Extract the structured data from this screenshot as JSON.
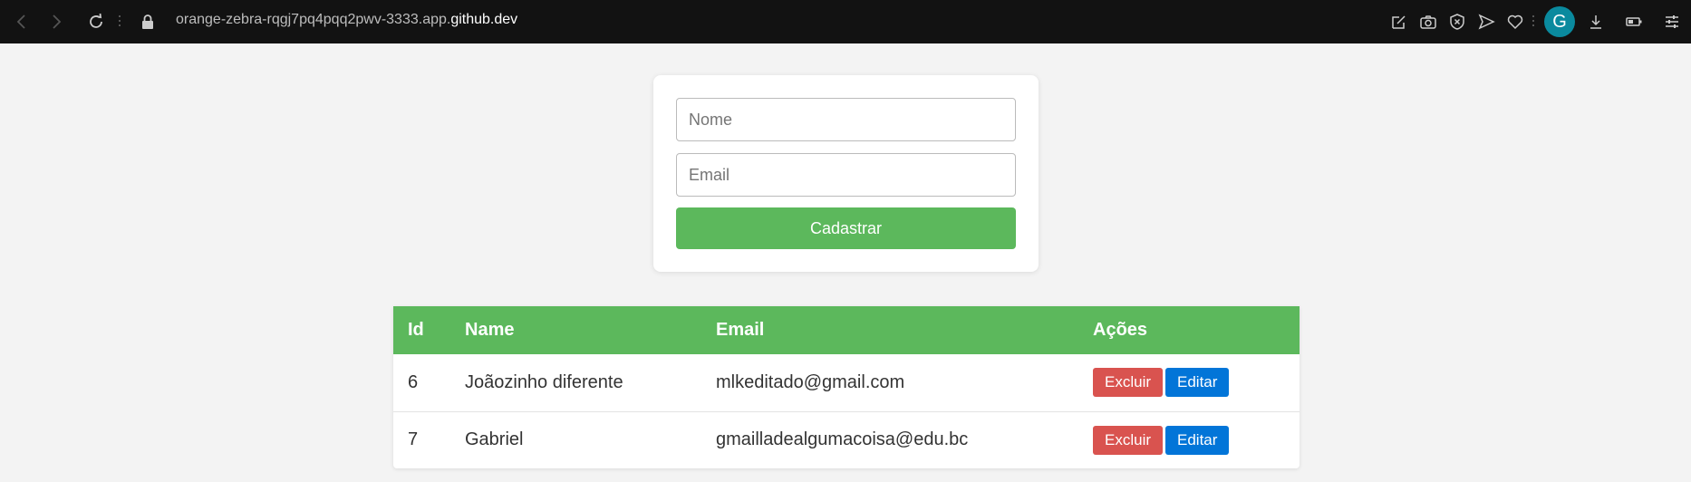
{
  "browser": {
    "url_prefix": "orange-zebra-rqgj7pq4pqq2pwv-3333.app.",
    "url_host": "github.dev",
    "avatar_letter": "G",
    "avatar_color": "#0a8a9e"
  },
  "form": {
    "name_placeholder": "Nome",
    "email_placeholder": "Email",
    "submit_label": "Cadastrar",
    "accent": "#5cb85c"
  },
  "table": {
    "headers": [
      "Id",
      "Name",
      "Email",
      "Ações"
    ],
    "rows": [
      {
        "id": "6",
        "name": "Joãozinho diferente",
        "email": "mlkeditado@gmail.com",
        "delete_label": "Excluir",
        "edit_label": "Editar"
      },
      {
        "id": "7",
        "name": "Gabriel",
        "email": "gmailladealgumacoisa@edu.bc",
        "delete_label": "Excluir",
        "edit_label": "Editar"
      }
    ],
    "colors": {
      "delete": "#d9534f",
      "edit": "#0275d8"
    }
  }
}
